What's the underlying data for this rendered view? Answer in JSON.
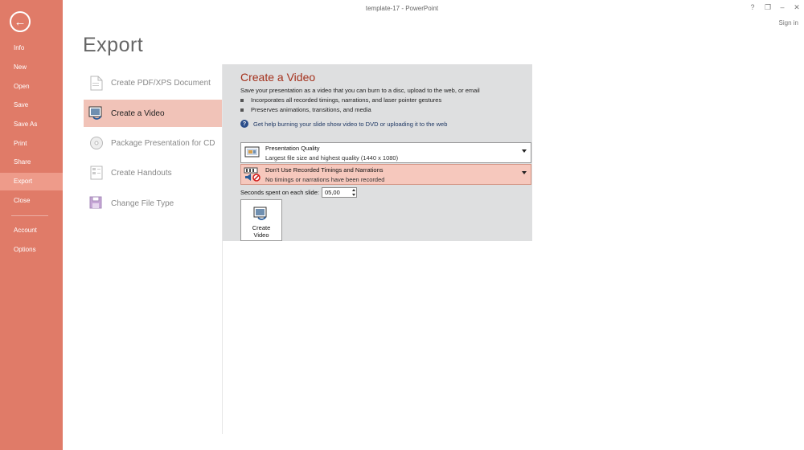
{
  "window": {
    "title": "template-17 - PowerPoint",
    "controls": {
      "help": "?",
      "restore": "❐",
      "minimize": "–",
      "maximize": "☐",
      "close": "✕"
    },
    "sign_in": "Sign in"
  },
  "sidebar": {
    "back_icon": "back-arrow-icon",
    "items": [
      {
        "label": "Info"
      },
      {
        "label": "New"
      },
      {
        "label": "Open"
      },
      {
        "label": "Save"
      },
      {
        "label": "Save As"
      },
      {
        "label": "Print"
      },
      {
        "label": "Share"
      },
      {
        "label": "Export",
        "active": true
      },
      {
        "label": "Close"
      },
      {
        "label": "Account"
      },
      {
        "label": "Options"
      }
    ]
  },
  "page_title": "Export",
  "export_options": [
    {
      "label": "Create PDF/XPS Document",
      "icon": "pdf-document-icon"
    },
    {
      "label": "Create a Video",
      "icon": "video-icon",
      "active": true
    },
    {
      "label": "Package Presentation for CD",
      "icon": "cd-package-icon"
    },
    {
      "label": "Create Handouts",
      "icon": "handouts-icon"
    },
    {
      "label": "Change File Type",
      "icon": "file-type-icon"
    }
  ],
  "panel": {
    "title": "Create a Video",
    "description": "Save your presentation as a video that you can burn to a disc, upload to the web, or email",
    "bullets": [
      "Incorporates all recorded timings, narrations, and laser pointer gestures",
      "Preserves animations, transitions, and media"
    ],
    "help_link": "Get help burning your slide show video to DVD or uploading it to the web",
    "quality_dropdown": {
      "title": "Presentation Quality",
      "subtitle": "Largest file size and highest quality (1440 x 1080)"
    },
    "timings_dropdown": {
      "title": "Don't Use Recorded Timings and Narrations",
      "subtitle": "No timings or narrations have been recorded"
    },
    "seconds_label": "Seconds spent on each slide:",
    "seconds_value": "05,00",
    "create_button": "Create Video"
  },
  "colors": {
    "accent": "#e07b68",
    "panel_title": "#a4311c",
    "selected": "#f1c3b8"
  }
}
